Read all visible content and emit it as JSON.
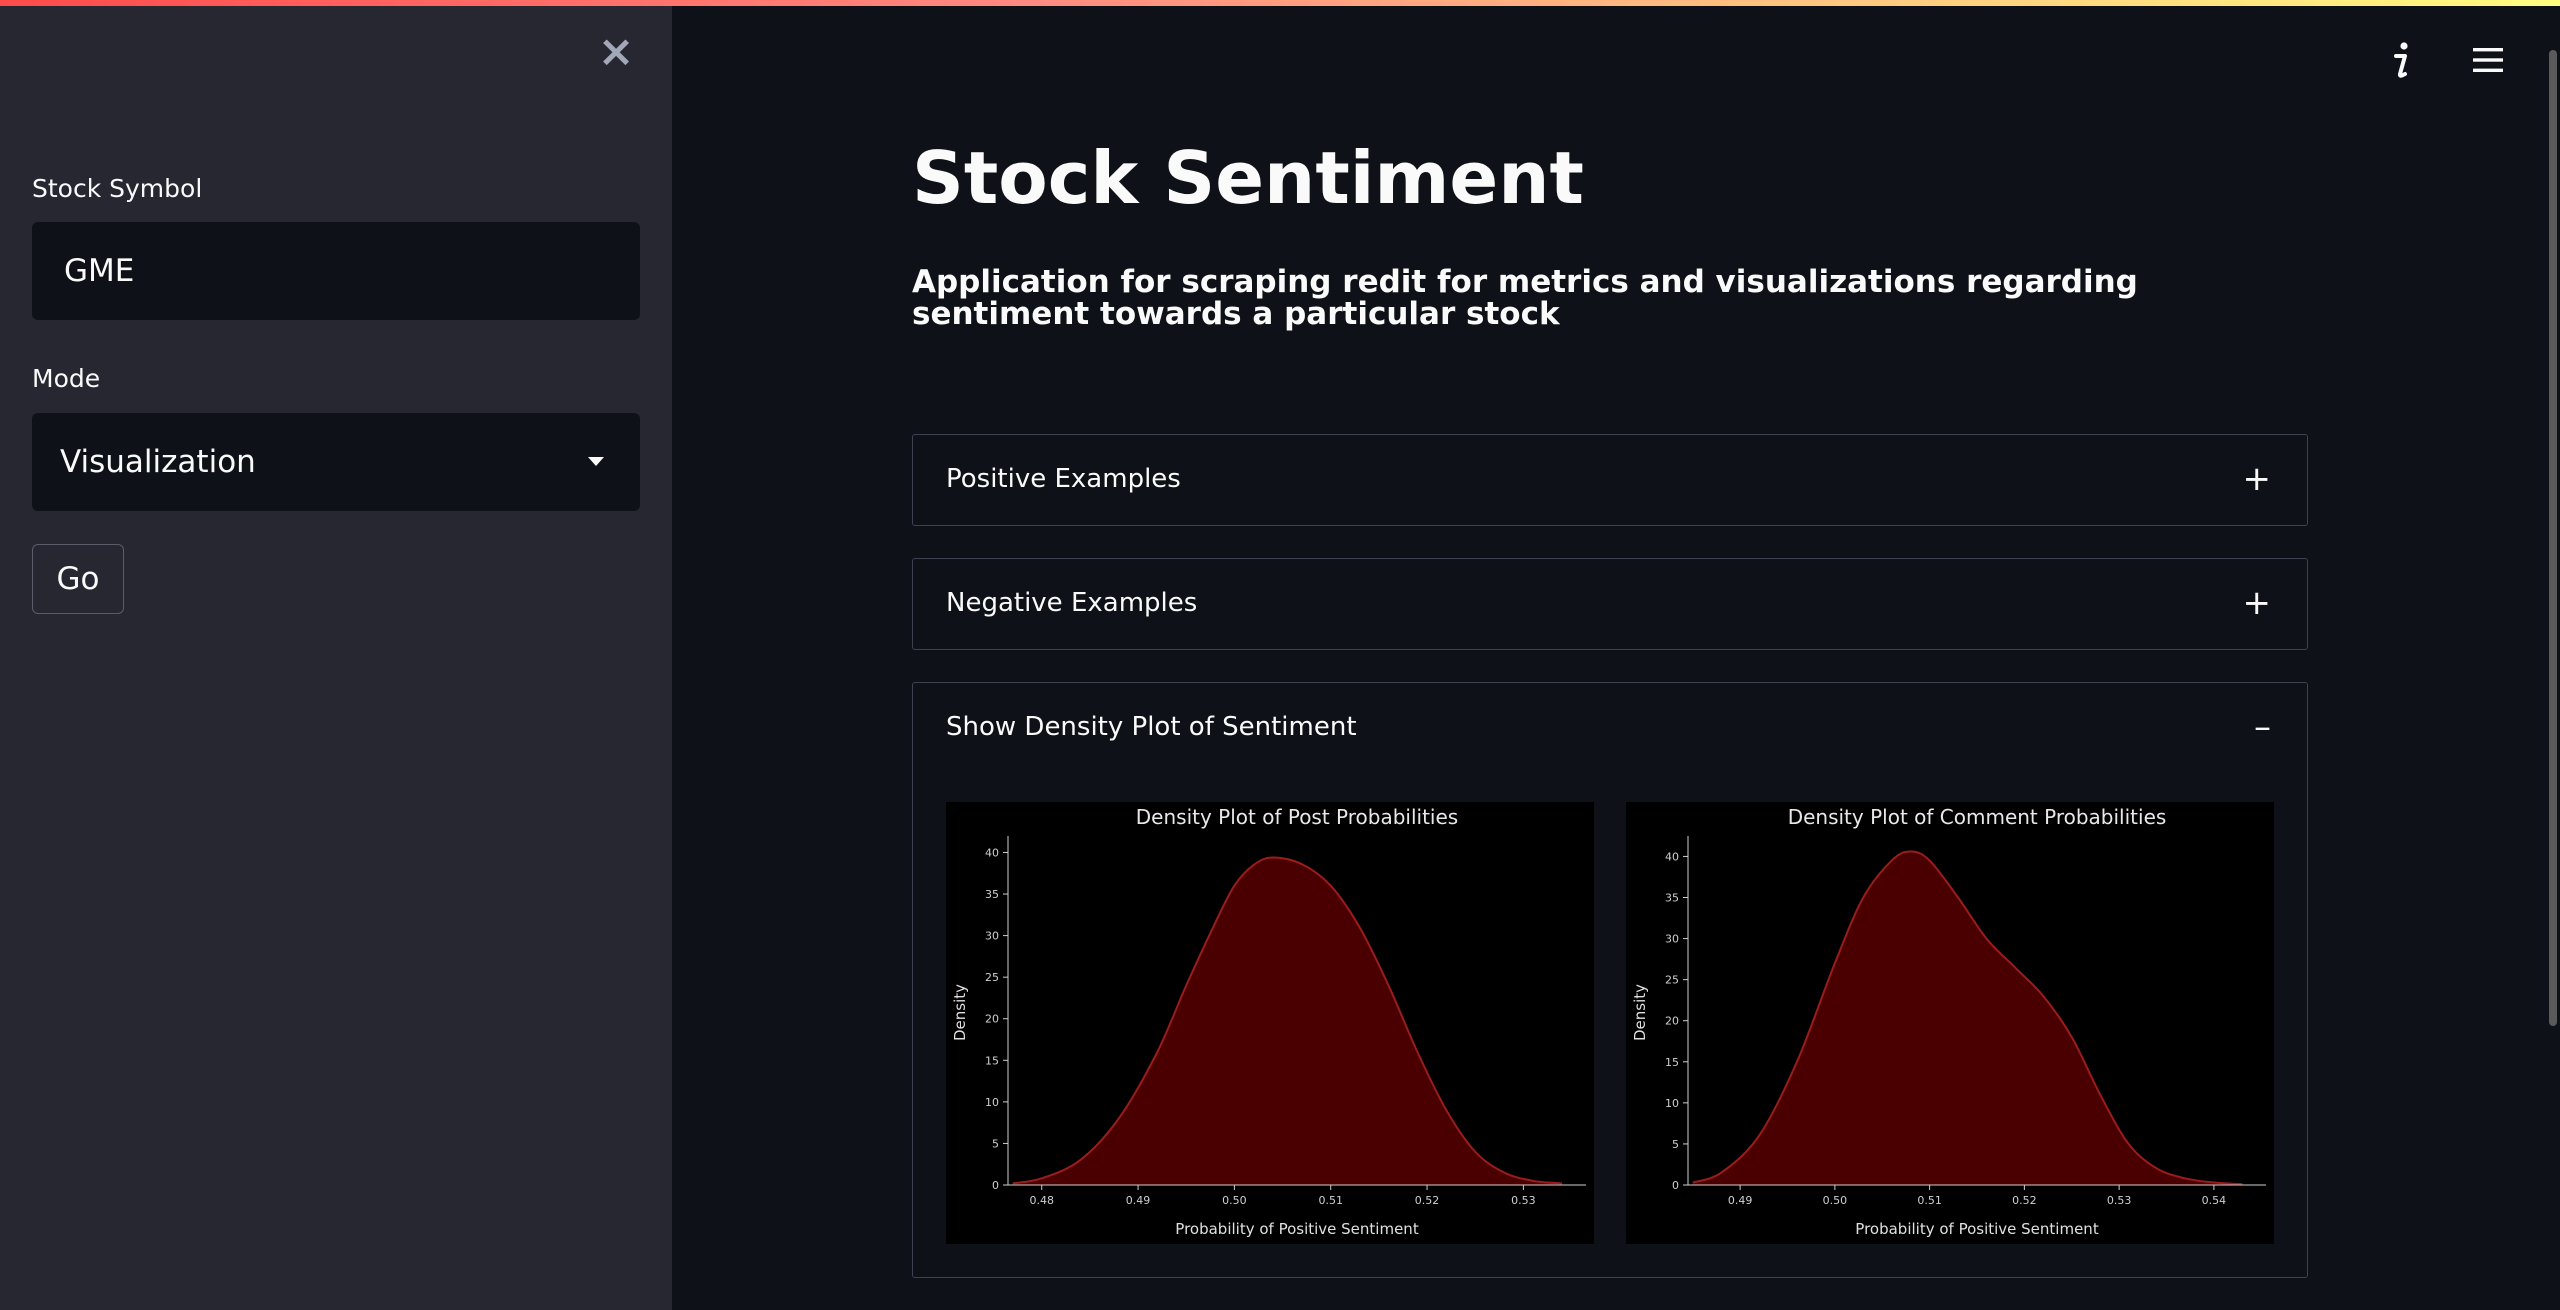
{
  "sidebar": {
    "close_icon": "close-icon",
    "symbol_label": "Stock Symbol",
    "symbol_value": "GME",
    "mode_label": "Mode",
    "mode_value": "Visualization",
    "go_label": "Go"
  },
  "header": {
    "icons": [
      "info-icon",
      "hamburger-menu-icon"
    ]
  },
  "main": {
    "title": "Stock Sentiment",
    "subtitle": "Application for scraping redit for metrics and visualizations regarding sentiment towards a particular stock",
    "expanders": [
      {
        "label": "Positive Examples",
        "toggle": "+"
      },
      {
        "label": "Negative Examples",
        "toggle": "+"
      },
      {
        "label": "Show Density Plot of Sentiment",
        "toggle": "–"
      }
    ]
  },
  "colors": {
    "accent_gradient": [
      "#ff4b4b",
      "#fffd80"
    ],
    "density_fill": "#4a0000",
    "density_line": "#9b1c1c"
  },
  "chart_data": [
    {
      "type": "area",
      "title": "Density Plot of Post Probabilities",
      "xlabel": "Probability of Positive Sentiment",
      "ylabel": "Density",
      "xticks": [
        "0.48",
        "0.49",
        "0.50",
        "0.51",
        "0.52",
        "0.53"
      ],
      "yticks": [
        "0",
        "5",
        "10",
        "15",
        "20",
        "25",
        "30",
        "35",
        "40"
      ],
      "xlim": [
        0.4765,
        0.5365
      ],
      "ylim": [
        0,
        41.5
      ],
      "series": [
        {
          "x": [
            0.477,
            0.48,
            0.484,
            0.488,
            0.492,
            0.495,
            0.498,
            0.5,
            0.502,
            0.504,
            0.507,
            0.51,
            0.513,
            0.516,
            0.519,
            0.522,
            0.525,
            0.528,
            0.531,
            0.534
          ],
          "y": [
            0.2,
            0.8,
            3,
            8,
            16,
            24,
            31.5,
            36,
            38.5,
            39.4,
            38.6,
            36,
            31,
            24,
            16,
            9,
            4,
            1.5,
            0.5,
            0.2
          ]
        }
      ]
    },
    {
      "type": "area",
      "title": "Density Plot of Comment Probabilities",
      "xlabel": "Probability of Positive Sentiment",
      "ylabel": "Density",
      "xticks": [
        "0.49",
        "0.50",
        "0.51",
        "0.52",
        "0.53",
        "0.54"
      ],
      "yticks": [
        "0",
        "5",
        "10",
        "15",
        "20",
        "25",
        "30",
        "35",
        "40"
      ],
      "xlim": [
        0.4845,
        0.5455
      ],
      "ylim": [
        0,
        42
      ],
      "series": [
        {
          "x": [
            0.485,
            0.488,
            0.492,
            0.496,
            0.5,
            0.503,
            0.506,
            0.508,
            0.51,
            0.513,
            0.516,
            0.519,
            0.522,
            0.525,
            0.528,
            0.531,
            0.534,
            0.537,
            0.54,
            0.543
          ],
          "y": [
            0.3,
            1.5,
            6,
            15,
            27,
            35,
            39.5,
            40.6,
            39.5,
            35,
            30,
            26.5,
            23,
            18,
            11,
            5,
            2,
            0.8,
            0.3,
            0.1
          ]
        }
      ]
    }
  ]
}
